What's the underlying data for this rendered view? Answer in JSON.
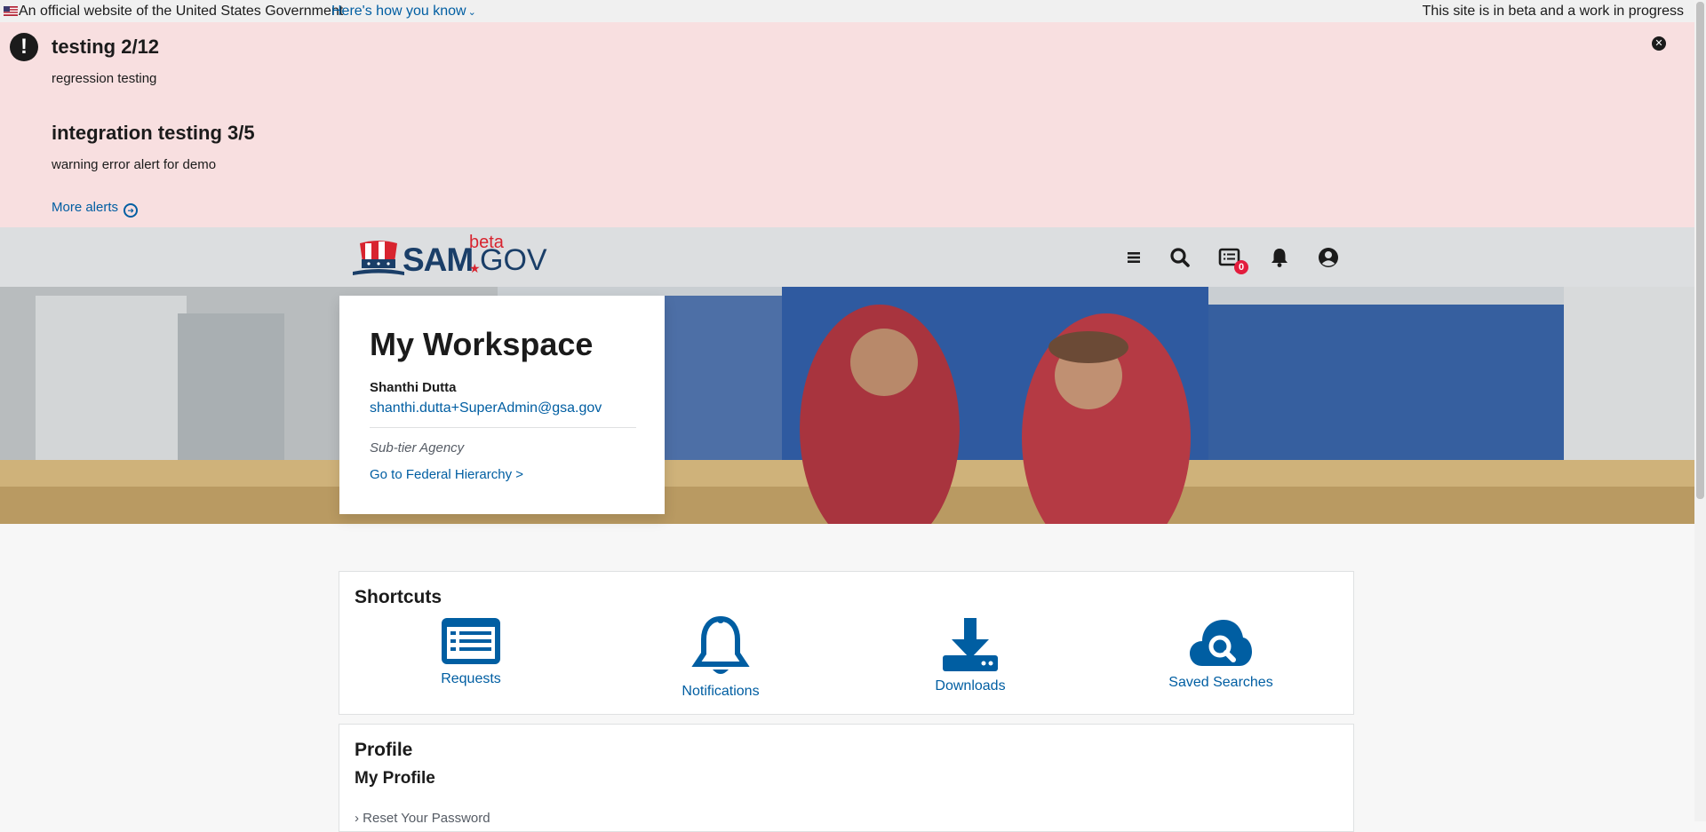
{
  "gov_banner": {
    "official_text": "An official website of the United States Government",
    "how_to_know": "Here's how you know",
    "beta_text": "This site is in beta and a work in progress"
  },
  "alerts": {
    "items": [
      {
        "title": "testing 2/12",
        "body": "regression testing"
      },
      {
        "title": "integration testing 3/5",
        "body": "warning error alert for demo"
      }
    ],
    "more_alerts": "More alerts",
    "background": "#f8dfe0"
  },
  "header": {
    "logo": {
      "sam": "SAM",
      "gov": "GOV",
      "beta": "beta"
    },
    "icons": [
      "menu-icon",
      "search-icon",
      "requests-icon",
      "notifications-icon",
      "account-icon"
    ],
    "requests_badge": "0"
  },
  "workspace": {
    "title": "My Workspace",
    "user_name": "Shanthi Dutta",
    "user_email": "shanthi.dutta+SuperAdmin@gsa.gov",
    "agency": "Sub-tier Agency",
    "hierarchy_link": "Go to Federal Hierarchy >"
  },
  "shortcuts": {
    "title": "Shortcuts",
    "items": [
      {
        "label": "Requests",
        "icon": "list-icon"
      },
      {
        "label": "Notifications",
        "icon": "bell-icon"
      },
      {
        "label": "Downloads",
        "icon": "download-icon"
      },
      {
        "label": "Saved Searches",
        "icon": "cloud-search-icon"
      }
    ]
  },
  "profile": {
    "title": "Profile",
    "subtitle": "My Profile",
    "reset_password": "Reset Your Password"
  },
  "colors": {
    "link": "#005ea2",
    "header_bg": "#dcdee0",
    "badge": "#e31c3d",
    "brand_red": "#d8242f",
    "brand_navy": "#1a3e68"
  }
}
